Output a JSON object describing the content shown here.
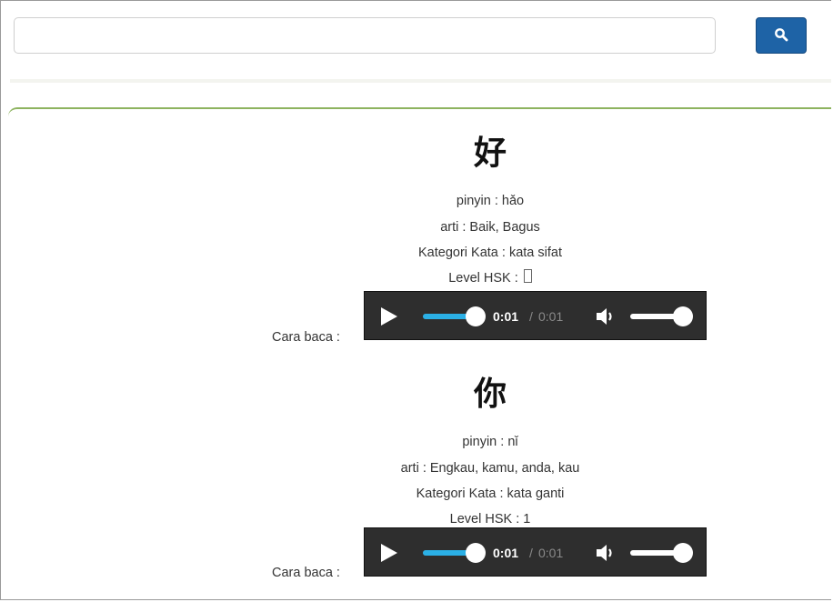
{
  "search": {
    "value": "",
    "placeholder": "",
    "button_icon": "search-icon"
  },
  "colors": {
    "search_button": "#1e63a6",
    "panel_border": "#8db35f",
    "player_bg": "#2e2e2e",
    "progress_fill": "#2bb0e6"
  },
  "entries": [
    {
      "hanzi": "好",
      "pinyin": "pinyin : hǎo",
      "arti": "arti : Baik, Bagus",
      "kategori": "Kategori Kata : kata sifat",
      "level_label": "Level HSK : ",
      "level_value": "",
      "cara_baca": "Cara baca :",
      "player": {
        "current_time": "0:01",
        "separator": "/",
        "total_time": "0:01",
        "progress": 1.0,
        "volume": 1.0,
        "icons": [
          "play-icon",
          "volume-icon"
        ]
      }
    },
    {
      "hanzi": "你",
      "pinyin": "pinyin : nǐ",
      "arti": "arti : Engkau, kamu, anda, kau",
      "kategori": "Kategori Kata : kata ganti",
      "level_label": "Level HSK : ",
      "level_value": "1",
      "cara_baca": "Cara baca :",
      "player": {
        "current_time": "0:01",
        "separator": "/",
        "total_time": "0:01",
        "progress": 1.0,
        "volume": 1.0,
        "icons": [
          "play-icon",
          "volume-icon"
        ]
      }
    }
  ]
}
